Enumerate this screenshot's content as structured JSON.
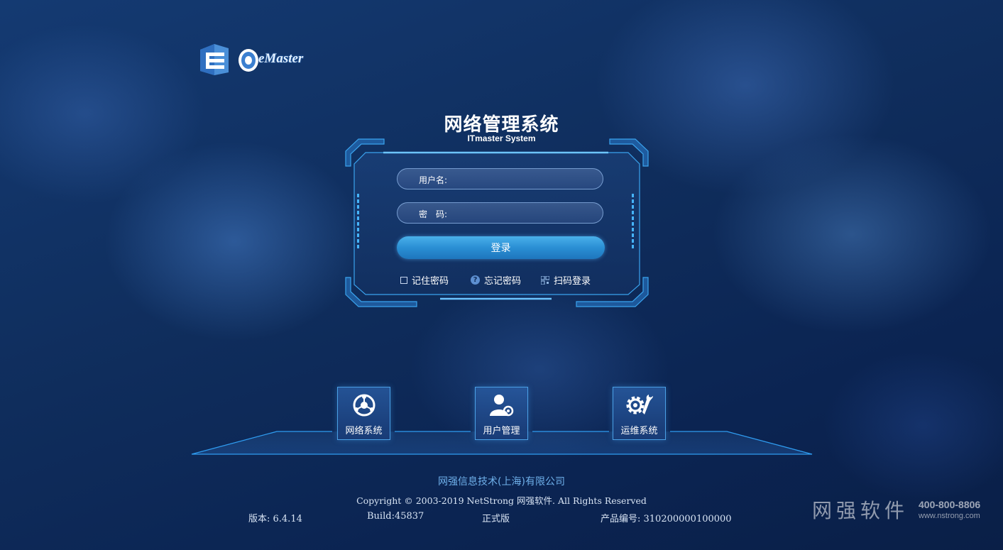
{
  "brand": {
    "logo_text": "eMaster"
  },
  "header": {
    "title": "网络管理系统",
    "subtitle": "ITmaster System"
  },
  "login": {
    "username_label": "用户名:",
    "username_value": "",
    "password_label": "密　码:",
    "password_value": "",
    "submit_label": "登录",
    "remember_label": "记住密码",
    "forgot_label": "忘记密码",
    "scan_label": "扫码登录"
  },
  "modules": [
    {
      "label": "网络系统",
      "icon": "network-globe-icon"
    },
    {
      "label": "用户管理",
      "icon": "user-gear-icon"
    },
    {
      "label": "运维系统",
      "icon": "gear-wrench-icon"
    }
  ],
  "footer": {
    "company": "网强信息技术(上海)有限公司",
    "copyright": "Copyright © 2003-2019 NetStrong 网强软件. All Rights Reserved",
    "version": "版本: 6.4.14",
    "build": "Build:45837",
    "edition": "正式版",
    "product_no": "产品编号: 310200000100000"
  },
  "watermark": {
    "name": "网强软件",
    "phone": "400-800-8806",
    "url": "www.nstrong.com"
  },
  "colors": {
    "accent": "#2a8fd4",
    "frame": "#3aa3ee",
    "company_text": "#6fb0ea"
  }
}
